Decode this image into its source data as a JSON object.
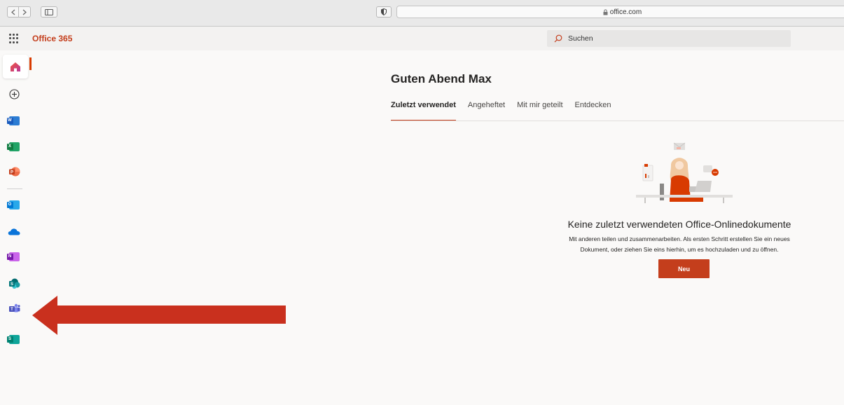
{
  "browser": {
    "url": "office.com"
  },
  "header": {
    "app_title": "Office 365",
    "search_placeholder": "Suchen"
  },
  "rail": {
    "items": [
      {
        "name": "home-icon"
      },
      {
        "name": "create-icon"
      },
      {
        "name": "word-icon",
        "letter": "W",
        "color": "#185abd"
      },
      {
        "name": "excel-icon",
        "letter": "X",
        "color": "#107c41"
      },
      {
        "name": "powerpoint-icon",
        "letter": "P",
        "color": "#c43e1c"
      },
      {
        "name": "outlook-icon",
        "letter": "O",
        "color": "#0078d4"
      },
      {
        "name": "onedrive-icon",
        "color": "#0364b8"
      },
      {
        "name": "onenote-icon",
        "letter": "N",
        "color": "#7719aa"
      },
      {
        "name": "sharepoint-icon",
        "letter": "S",
        "color": "#03787c"
      },
      {
        "name": "teams-icon",
        "letter": "T",
        "color": "#5059c9"
      },
      {
        "name": "sway-icon",
        "letter": "S",
        "color": "#008272"
      }
    ]
  },
  "main": {
    "greeting": "Guten Abend Max",
    "tabs": [
      {
        "label": "Zuletzt verwendet",
        "selected": true
      },
      {
        "label": "Angeheftet",
        "selected": false
      },
      {
        "label": "Mit mir geteilt",
        "selected": false
      },
      {
        "label": "Entdecken",
        "selected": false
      }
    ],
    "empty_title": "Keine zuletzt verwendeten Office-Onlinedokumente",
    "empty_desc_line1": "Mit anderen teilen und zusammenarbeiten. Als ersten Schritt erstellen Sie ein neues",
    "empty_desc_line2": "Dokument, oder ziehen Sie eins hierhin, um es hochzuladen und zu öffnen.",
    "new_button": "Neu"
  },
  "colors": {
    "accent": "#c43e1c",
    "annotation_arrow": "#c9301e"
  }
}
